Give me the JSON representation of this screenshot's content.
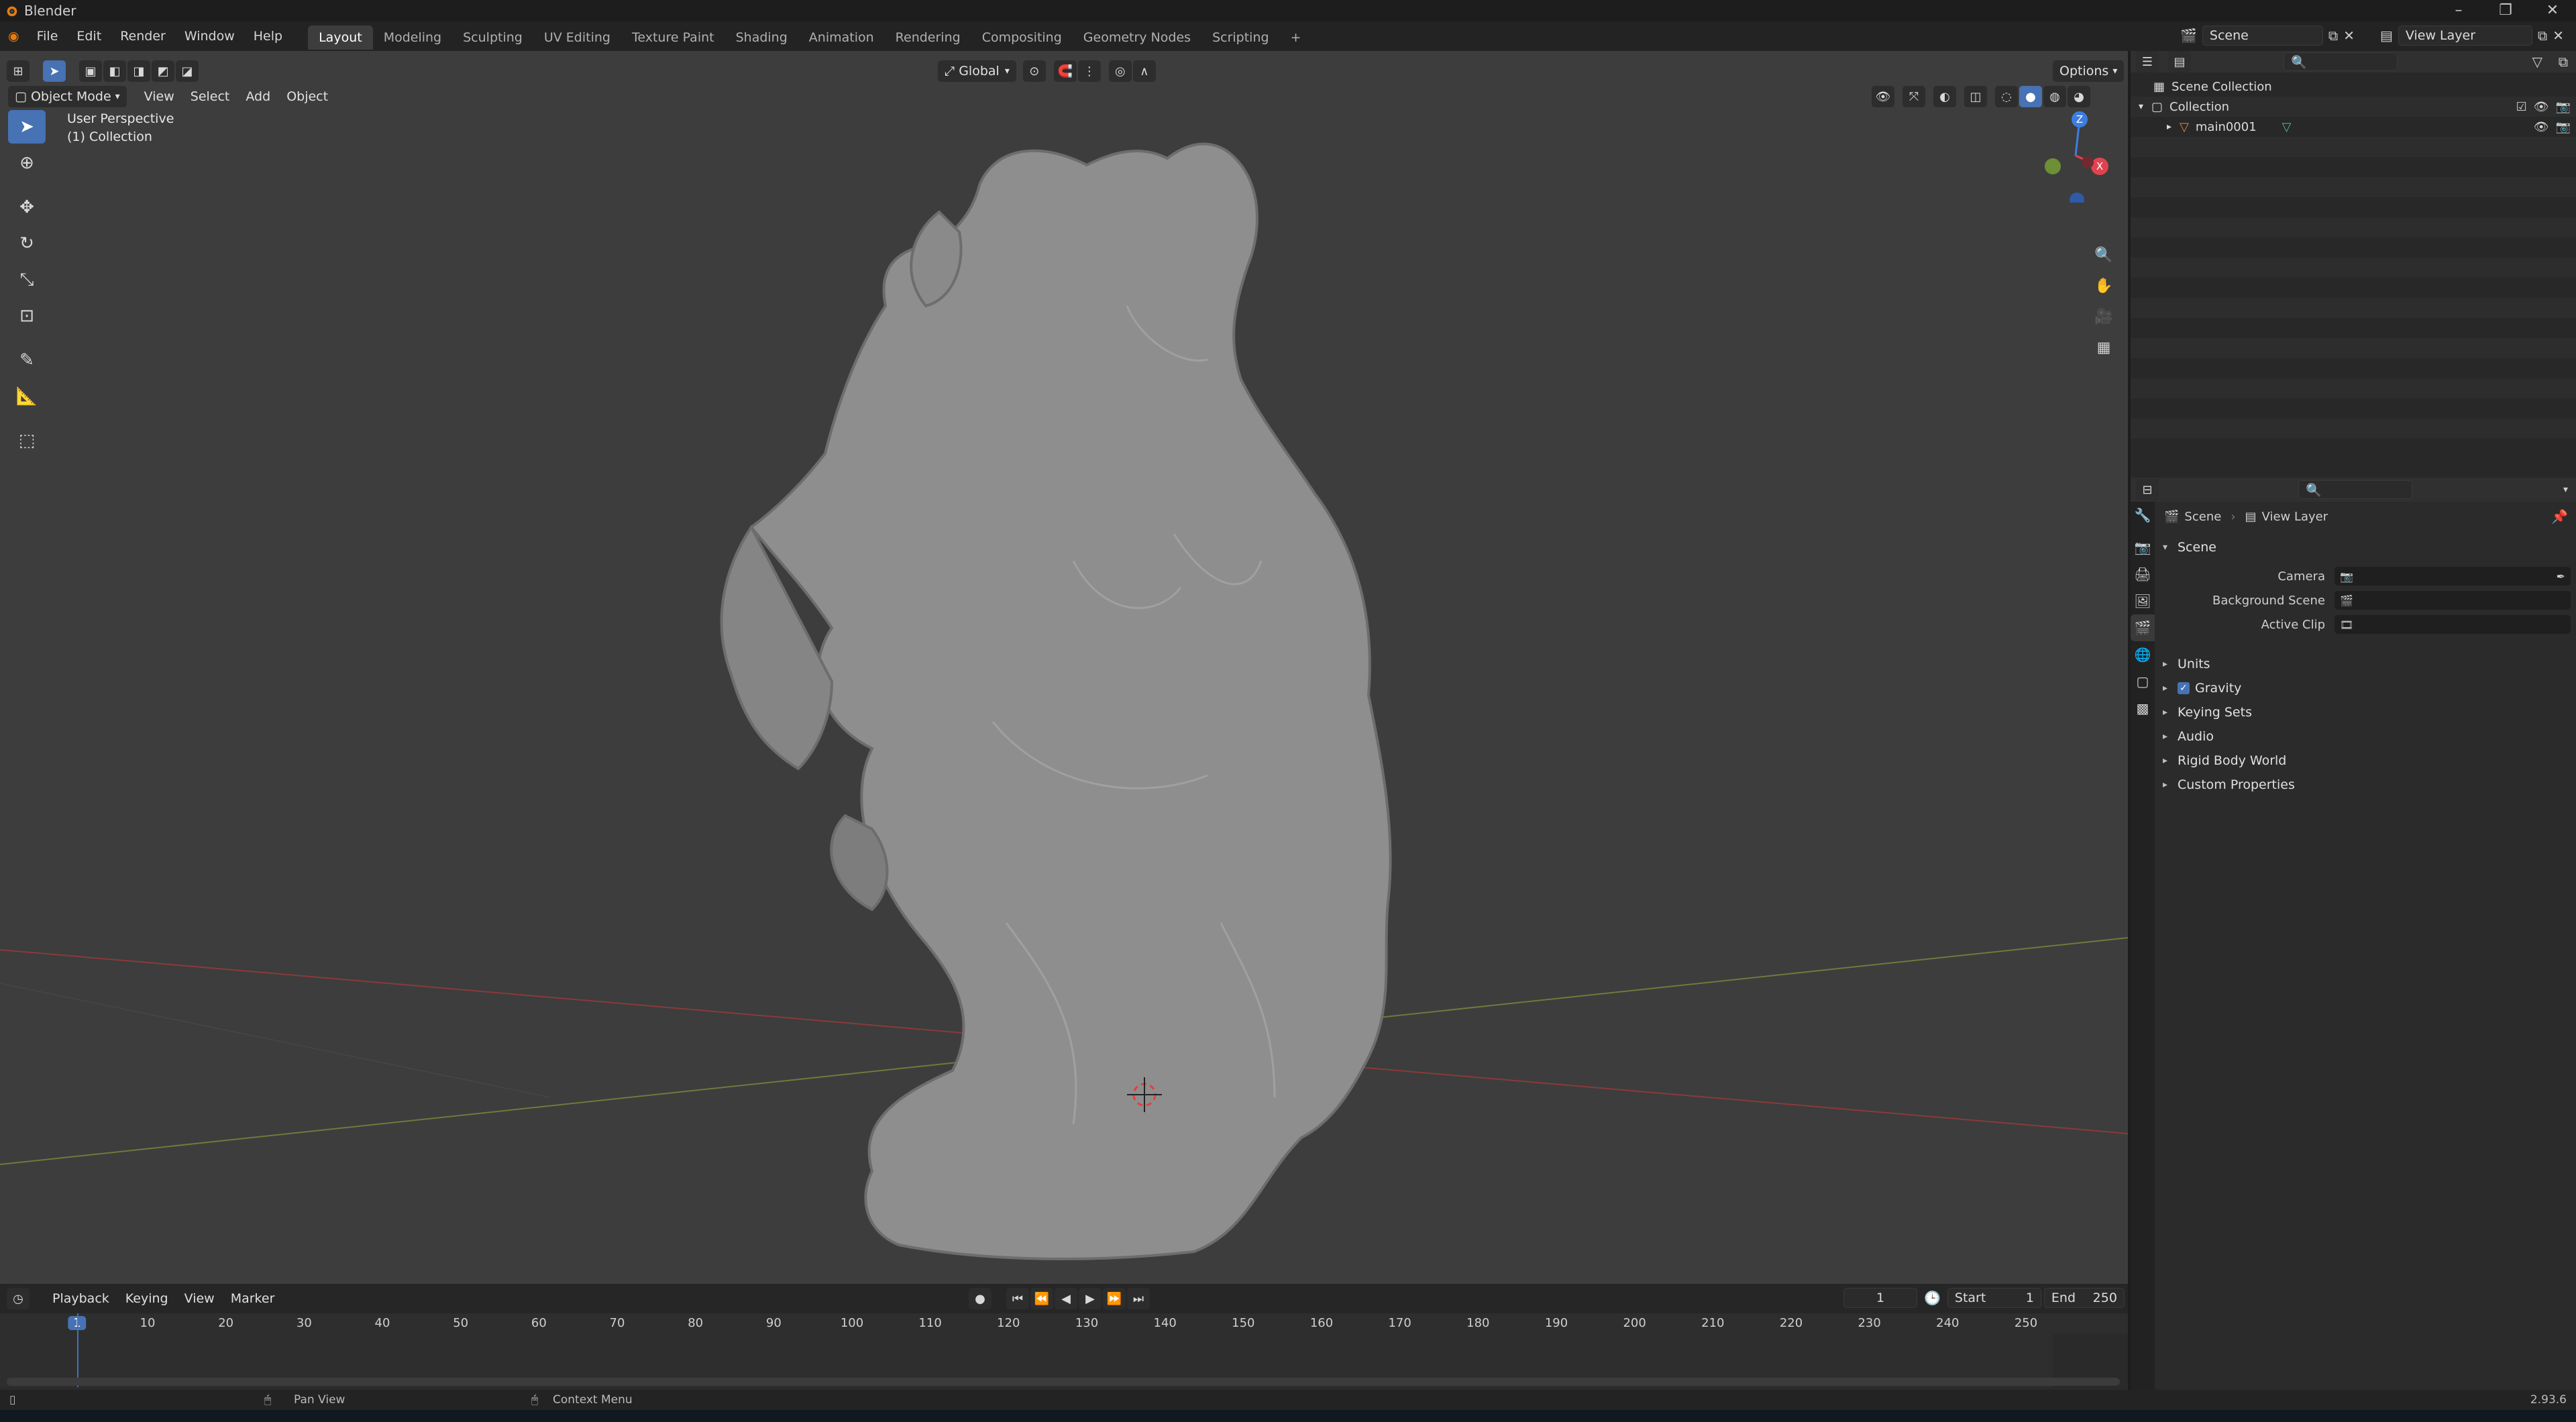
{
  "window": {
    "title": "Blender",
    "controls": [
      "–",
      "❐",
      "✕"
    ]
  },
  "menu": {
    "items": [
      "File",
      "Edit",
      "Render",
      "Window",
      "Help"
    ],
    "workspaces": [
      "Layout",
      "Modeling",
      "Sculpting",
      "UV Editing",
      "Texture Paint",
      "Shading",
      "Animation",
      "Rendering",
      "Compositing",
      "Geometry Nodes",
      "Scripting"
    ],
    "active_workspace": "Layout",
    "scene": "Scene",
    "view_layer": "View Layer"
  },
  "viewport": {
    "mode": "Object Mode",
    "menus": [
      "View",
      "Select",
      "Add",
      "Object"
    ],
    "orientation": "Global",
    "options": "Options",
    "info_line1": "User Perspective",
    "info_line2": "(1) Collection",
    "gizmo_axes": {
      "z": "Z",
      "x": "X"
    }
  },
  "outliner": {
    "rows": [
      {
        "label": "Scene Collection"
      },
      {
        "label": "Collection"
      },
      {
        "label": "main0001"
      }
    ]
  },
  "properties": {
    "breadcrumb": [
      "Scene",
      "View Layer"
    ],
    "section": "Scene",
    "fields": [
      {
        "label": "Camera",
        "value": ""
      },
      {
        "label": "Background Scene",
        "value": ""
      },
      {
        "label": "Active Clip",
        "value": ""
      }
    ],
    "panels": [
      "Units",
      "Gravity",
      "Keying Sets",
      "Audio",
      "Rigid Body World",
      "Custom Properties"
    ],
    "gravity_checked": true
  },
  "timeline": {
    "menus": [
      "Playback",
      "Keying",
      "View",
      "Marker"
    ],
    "current_frame": "1",
    "start_label": "Start",
    "start": "1",
    "end_label": "End",
    "end": "250",
    "ticks": [
      "1",
      "10",
      "20",
      "30",
      "40",
      "50",
      "60",
      "70",
      "80",
      "90",
      "100",
      "110",
      "120",
      "130",
      "140",
      "150",
      "160",
      "170",
      "180",
      "190",
      "200",
      "210",
      "220",
      "230",
      "240",
      "250"
    ]
  },
  "status": {
    "pan_view": "Pan View",
    "context_menu": "Context Menu",
    "version": "2.93.6"
  },
  "colors": {
    "accent": "#4772b3",
    "viewport_bg": "#3d3d3d",
    "x_axis": "#e0434f",
    "y_axis": "#8ab34a",
    "z_axis": "#3e7de0"
  }
}
